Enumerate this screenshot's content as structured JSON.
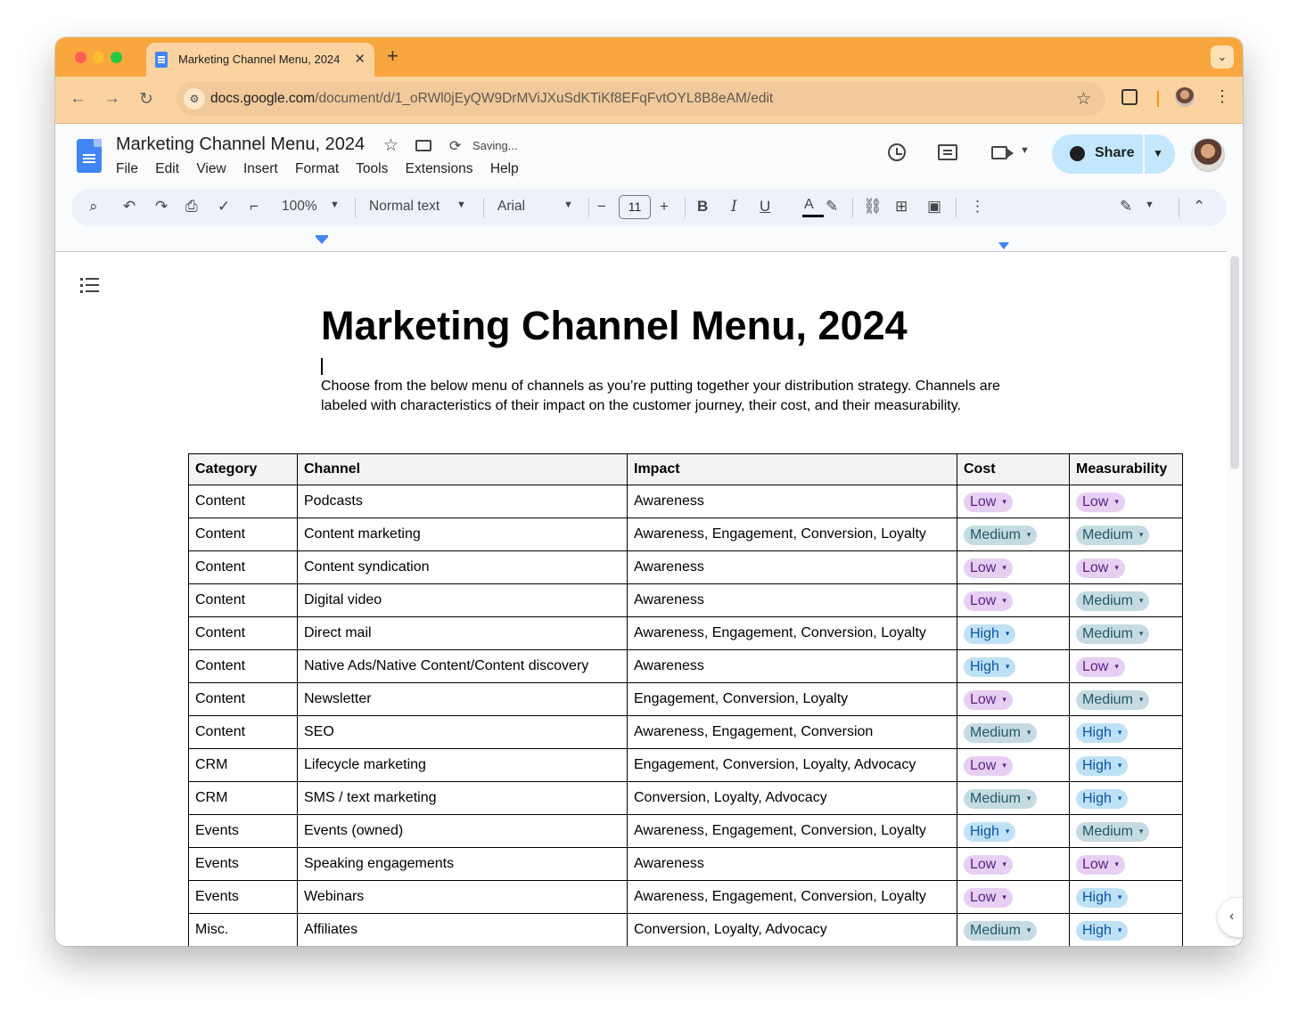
{
  "browser": {
    "tab_title": "Marketing Channel Menu, 2024",
    "new_tab_symbol": "+",
    "close_symbol": "✕",
    "url_host": "docs.google.com",
    "url_path": "/document/d/1_oRWl0jEyQW9DrMViJXuSdKTiKf8EFqFvtOYL8B8eAM/edit",
    "icons": [
      "back-arrow-icon",
      "forward-arrow-icon",
      "reload-icon",
      "site-settings-icon",
      "bookmark-star-icon",
      "extensions-icon",
      "profile-icon",
      "more-icon"
    ]
  },
  "docs_header": {
    "title": "Marketing Channel Menu, 2024",
    "saving_status": "Saving...",
    "menu": [
      "File",
      "Edit",
      "View",
      "Insert",
      "Format",
      "Tools",
      "Extensions",
      "Help"
    ],
    "share_label": "Share"
  },
  "format_toolbar": {
    "zoom": "100%",
    "style": "Normal text",
    "font": "Arial",
    "font_size": "11",
    "bold": "B",
    "italic": "I",
    "underline": "U",
    "text_color": "A"
  },
  "document": {
    "heading": "Marketing Channel Menu, 2024",
    "intro": "Choose from the below menu of channels as you’re putting together your distribution strategy. Channels are labeled with characteristics of their impact on the customer journey, their cost, and their measurability.",
    "table": {
      "headers": [
        "Category",
        "Channel",
        "Impact",
        "Cost",
        "Measurability"
      ],
      "rows": [
        [
          "Content",
          "Podcasts",
          "Awareness",
          "Low",
          "Low"
        ],
        [
          "Content",
          "Content marketing",
          "Awareness, Engagement, Conversion, Loyalty",
          "Medium",
          "Medium"
        ],
        [
          "Content",
          "Content syndication",
          "Awareness",
          "Low",
          "Low"
        ],
        [
          "Content",
          "Digital video",
          "Awareness",
          "Low",
          "Medium"
        ],
        [
          "Content",
          "Direct mail",
          "Awareness, Engagement, Conversion, Loyalty",
          "High",
          "Medium"
        ],
        [
          "Content",
          "Native Ads/Native Content/Content discovery",
          "Awareness",
          "High",
          "Low"
        ],
        [
          "Content",
          "Newsletter",
          "Engagement, Conversion, Loyalty",
          "Low",
          "Medium"
        ],
        [
          "Content",
          "SEO",
          "Awareness, Engagement, Conversion",
          "Medium",
          "High"
        ],
        [
          "CRM",
          "Lifecycle marketing",
          "Engagement, Conversion, Loyalty, Advocacy",
          "Low",
          "High"
        ],
        [
          "CRM",
          "SMS / text marketing",
          "Conversion, Loyalty, Advocacy",
          "Medium",
          "High"
        ],
        [
          "Events",
          "Events (owned)",
          "Awareness, Engagement, Conversion, Loyalty",
          "High",
          "Medium"
        ],
        [
          "Events",
          "Speaking engagements",
          "Awareness",
          "Low",
          "Low"
        ],
        [
          "Events",
          "Webinars",
          "Awareness, Engagement, Conversion, Loyalty",
          "Low",
          "High"
        ],
        [
          "Misc.",
          "Affiliates",
          "Conversion, Loyalty, Advocacy",
          "Medium",
          "High"
        ]
      ]
    },
    "chip_colors": {
      "low": "#e6cff2",
      "medium": "#c6dbe1",
      "high": "#bfe1f6"
    }
  },
  "colors": {
    "tabstrip": "#f8a63e",
    "toolbar": "#fbd3a0",
    "share_button": "#c2e7ff",
    "docs_blue": "#4285f4"
  }
}
